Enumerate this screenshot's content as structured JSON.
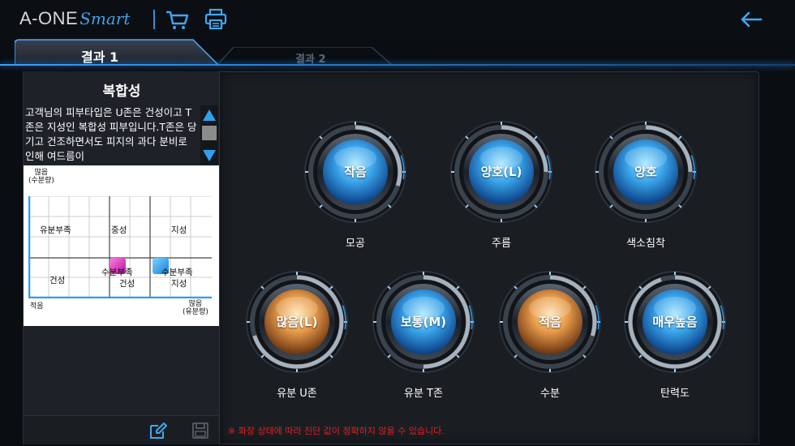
{
  "header": {
    "brand_main": "A-ONE",
    "brand_script": "Smart",
    "cart_icon": "cart-icon",
    "print_icon": "printer-icon",
    "back_icon": "back-arrow-icon"
  },
  "tabs": [
    {
      "label": "결과 1",
      "active": true
    },
    {
      "label": "결과 2",
      "active": false
    }
  ],
  "left_panel": {
    "title": "복합성",
    "description": "고객님의 피부타입은 U존은 건성이고 T존은 지성인 복합성 피부입니다.T존은 당기고 건조하면서도 피지의 과다 분비로 인해 여드름이",
    "chart": {
      "y_axis_top": [
        "많음",
        "(수분량)"
      ],
      "x_axis_left": "적음",
      "x_axis_right": [
        "많음",
        "(유분량)"
      ],
      "cells": {
        "top_left": "유분부족",
        "top_mid": "중성",
        "top_right": "지성",
        "bottom_left": "건성",
        "bottom_mid_1": "수분부족",
        "bottom_mid_2": "건성",
        "bottom_right_1": "수분부족",
        "bottom_right_2": "지성"
      },
      "marker_colors": {
        "u_zone": "#e040c8",
        "t_zone": "#2a9ef0"
      }
    },
    "edit_icon": "edit-icon",
    "save_icon": "save-icon"
  },
  "gauges": [
    {
      "value": "작음",
      "label": "모공",
      "type": "blue",
      "level": 0.3
    },
    {
      "value": "양호(L)",
      "label": "주름",
      "type": "blue",
      "level": 0.25
    },
    {
      "value": "양호",
      "label": "색소침착",
      "type": "blue",
      "level": 0.25
    },
    {
      "value": "많음(L)",
      "label": "유분 U존",
      "type": "orange",
      "level": 0.7
    },
    {
      "value": "보통(M)",
      "label": "유분 T존",
      "type": "blue",
      "level": 0.5
    },
    {
      "value": "적음",
      "label": "수분",
      "type": "orange",
      "level": 0.3
    },
    {
      "value": "매우높음",
      "label": "탄력도",
      "type": "blue",
      "level": 0.95
    }
  ],
  "notice": "※ 화장 상태에 따라 진단 값이 정확하지 않을 수 있습니다.",
  "colors": {
    "accent": "#2a9ef0",
    "warning": "#e02020"
  }
}
